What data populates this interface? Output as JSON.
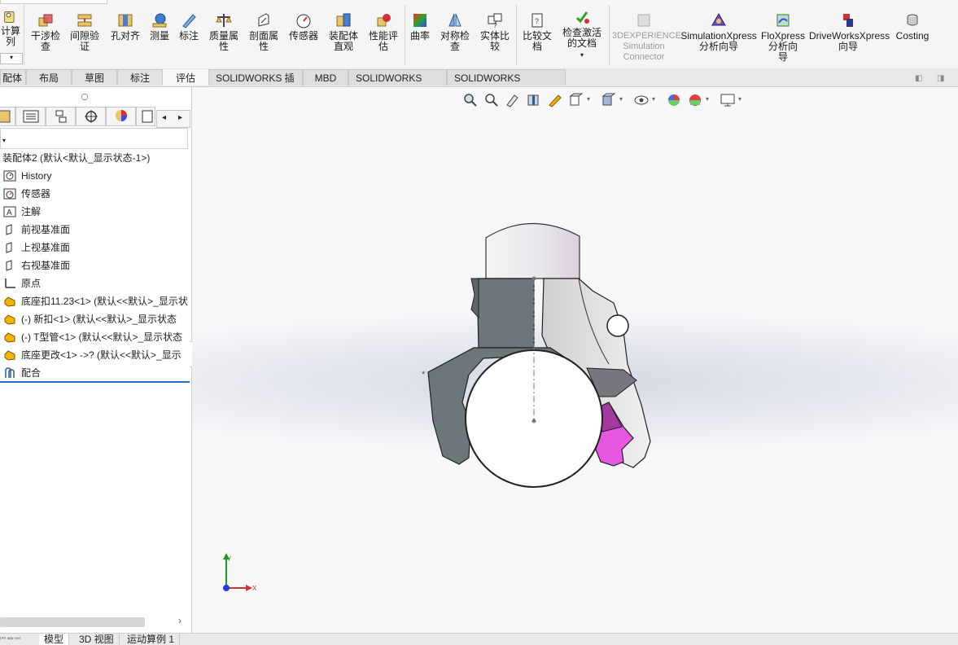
{
  "ribbon": {
    "left_partial": {
      "line1": "计算",
      "line2": "列"
    },
    "tools": [
      {
        "id": "interference",
        "line1": "干涉检",
        "line2": "查"
      },
      {
        "id": "clearance",
        "line1": "间隙验",
        "line2": "证"
      },
      {
        "id": "hole-align",
        "line1": "孔对齐",
        "line2": ""
      },
      {
        "id": "measure",
        "line1": "测量",
        "line2": ""
      },
      {
        "id": "markup",
        "line1": "标注",
        "line2": ""
      },
      {
        "id": "mass-props",
        "line1": "质量属",
        "line2": "性"
      },
      {
        "id": "section-props",
        "line1": "剖面属",
        "line2": "性"
      },
      {
        "id": "sensor",
        "line1": "传感器",
        "line2": ""
      },
      {
        "id": "assembly-visual",
        "line1": "装配体",
        "line2": "直观"
      },
      {
        "id": "perf-eval",
        "line1": "性能评",
        "line2": "估"
      },
      {
        "id": "curvature",
        "line1": "曲率",
        "line2": ""
      },
      {
        "id": "symmetry",
        "line1": "对称检",
        "line2": "查"
      },
      {
        "id": "compare-solid",
        "line1": "实体比",
        "line2": "较"
      },
      {
        "id": "compare-doc",
        "line1": "比较文",
        "line2": "档"
      },
      {
        "id": "check-active",
        "line1": "检查激活",
        "line2": "的文档"
      },
      {
        "id": "3dx-sim",
        "line1": "3DEXPERIENCE",
        "line2": "Simulation",
        "line3": "Connector"
      },
      {
        "id": "simxpress",
        "line1": "SimulationXpress",
        "line2": "分析向导"
      },
      {
        "id": "floxpress",
        "line1": "FloXpress",
        "line2": "分析向",
        "line3": "导"
      },
      {
        "id": "driveworks",
        "line1": "DriveWorksXpress",
        "line2": "向导"
      },
      {
        "id": "costing",
        "line1": "Costing",
        "line2": ""
      }
    ]
  },
  "tabs": [
    {
      "label": "配体"
    },
    {
      "label": "布局"
    },
    {
      "label": "草图"
    },
    {
      "label": "标注"
    },
    {
      "label": "评估"
    },
    {
      "label": "SOLIDWORKS 插件"
    },
    {
      "label": "MBD"
    },
    {
      "label": "SOLIDWORKS CAM"
    },
    {
      "label": "SOLIDWORKS Inspection"
    }
  ],
  "tree": {
    "root": "装配体2 (默认<默认_显示状态-1>)",
    "items": [
      {
        "label": "History",
        "icon": "history-icon"
      },
      {
        "label": "传感器",
        "icon": "sensor-icon"
      },
      {
        "label": "注解",
        "icon": "annotation-icon"
      },
      {
        "label": "前视基准面",
        "icon": "plane-icon"
      },
      {
        "label": "上视基准面",
        "icon": "plane-icon"
      },
      {
        "label": "右视基准面",
        "icon": "plane-icon"
      },
      {
        "label": "原点",
        "icon": "origin-icon"
      },
      {
        "label": "底座扣11.23<1> (默认<<默认>_显示状",
        "icon": "part-icon"
      },
      {
        "label": "(-) 新扣<1> (默认<<默认>_显示状态",
        "icon": "part-icon"
      },
      {
        "label": "(-) T型管<1> (默认<<默认>_显示状态",
        "icon": "part-icon"
      },
      {
        "label": "底座更改<1> ->? (默认<<默认>_显示",
        "icon": "part-icon"
      },
      {
        "label": "配合",
        "icon": "mates-icon"
      }
    ]
  },
  "bottom_tabs": [
    {
      "label": "模型"
    },
    {
      "label": "3D 视图"
    },
    {
      "label": "运动算例 1"
    }
  ],
  "triad": {
    "x_label": "X",
    "y_label": "Y"
  },
  "colors": {
    "accent": "#1f6fc1",
    "magenta": "#e657e0",
    "dark_gray": "#6c767b"
  }
}
